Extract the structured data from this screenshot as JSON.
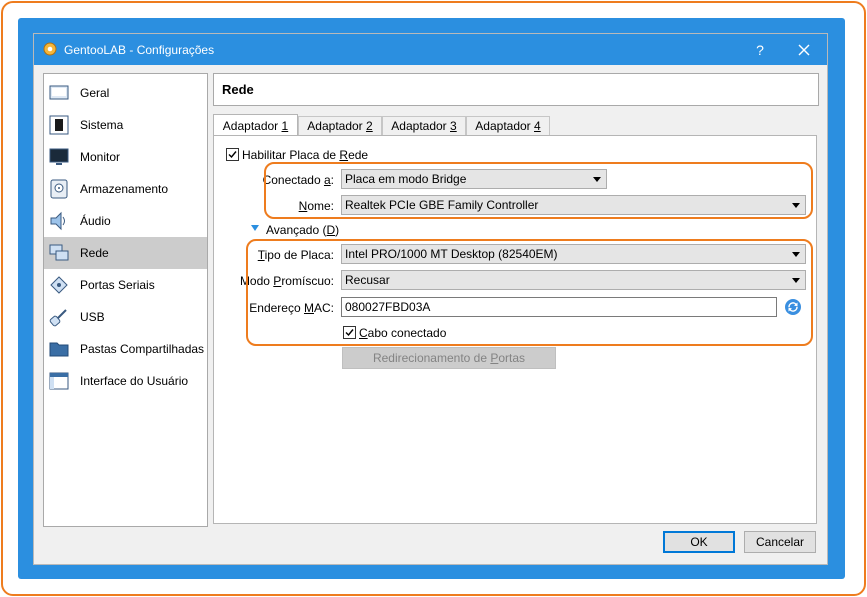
{
  "window": {
    "title": "GentooLAB - Configurações",
    "help_label": "?"
  },
  "sidebar": {
    "items": [
      {
        "label": "Geral"
      },
      {
        "label": "Sistema"
      },
      {
        "label": "Monitor"
      },
      {
        "label": "Armazenamento"
      },
      {
        "label": "Áudio"
      },
      {
        "label": "Rede",
        "selected": true
      },
      {
        "label": "Portas Seriais"
      },
      {
        "label": "USB"
      },
      {
        "label": "Pastas Compartilhadas"
      },
      {
        "label": "Interface do Usuário"
      }
    ]
  },
  "page": {
    "title": "Rede"
  },
  "tabs": [
    {
      "label_pre": "Adaptador ",
      "label_key": "1",
      "active": true
    },
    {
      "label_pre": "Adaptador ",
      "label_key": "2"
    },
    {
      "label_pre": "Adaptador ",
      "label_key": "3"
    },
    {
      "label_pre": "Adaptador ",
      "label_key": "4"
    }
  ],
  "adapter": {
    "enable_pre": "Habilitar Placa de ",
    "enable_key": "R",
    "enable_post": "ede",
    "enable_checked": true,
    "attached_pre": "Conectado ",
    "attached_key": "a",
    "attached_post": ":",
    "attached_value": "Placa em modo Bridge",
    "name_key": "N",
    "name_post": "ome:",
    "name_value": "Realtek PCIe GBE Family Controller",
    "advanced_pre": "Avançado (",
    "advanced_key": "D",
    "advanced_post": ")",
    "adapter_type_key": "T",
    "adapter_type_post": "ipo de Placa:",
    "adapter_type_value": "Intel PRO/1000 MT Desktop (82540EM)",
    "promisc_pre": "Modo ",
    "promisc_key": "P",
    "promisc_post": "romíscuo:",
    "promisc_value": "Recusar",
    "mac_pre": "Endereço ",
    "mac_key": "M",
    "mac_post": "AC:",
    "mac_value": "080027FBD03A",
    "cable_key": "C",
    "cable_post": "abo conectado",
    "cable_checked": true,
    "port_forward_pre": "Redirecionamento de ",
    "port_forward_key": "P",
    "port_forward_post": "ortas"
  },
  "footer": {
    "ok_label": "OK",
    "cancel_label": "Cancelar"
  },
  "colors": {
    "highlight": "#ee7c1e",
    "desktop": "#2b8fe0",
    "selected_item": "#cccccc"
  },
  "icons": [
    "gear-icon",
    "general-icon",
    "chip-icon",
    "monitor-icon",
    "disk-icon",
    "speaker-icon",
    "network-icon",
    "serial-port-icon",
    "usb-icon",
    "folder-icon",
    "window-icon",
    "refresh-icon",
    "close-icon",
    "expand-triangle-icon"
  ]
}
